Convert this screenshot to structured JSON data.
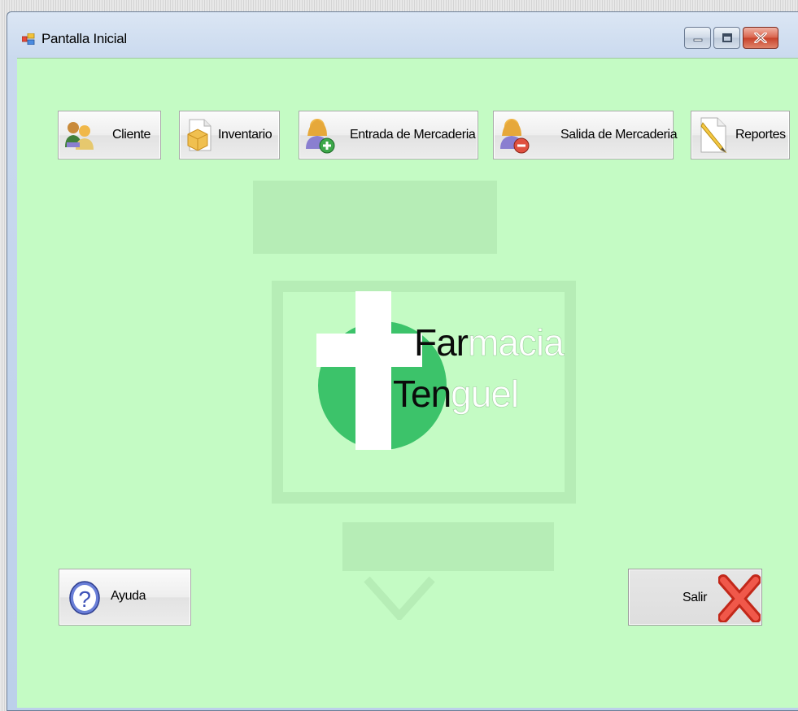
{
  "window": {
    "title": "Pantalla Inicial",
    "controls": [
      "minimize",
      "maximize",
      "close"
    ]
  },
  "toolbar": {
    "buttons": [
      {
        "label": "Cliente",
        "icon": "users-icon"
      },
      {
        "label": "Inventario",
        "icon": "package-icon"
      },
      {
        "label": "Entrada de Mercaderia",
        "icon": "user-add-icon"
      },
      {
        "label": "Salida de Mercaderia",
        "icon": "user-remove-icon"
      },
      {
        "label": "Reportes",
        "icon": "pencil-document-icon"
      }
    ]
  },
  "logo": {
    "line1_dark": "Far",
    "line1_light": "macia",
    "line2_dark": "Ten",
    "line2_light": "guel",
    "colors": {
      "circle": "#3cc36a",
      "cross": "#ffffff"
    }
  },
  "footer": {
    "help_label": "Ayuda",
    "help_icon": "help-icon",
    "exit_label": "Salir",
    "exit_icon": "red-x-icon"
  },
  "colors": {
    "client_background": "#c4fbc4",
    "accent_green": "#3cc36a"
  }
}
